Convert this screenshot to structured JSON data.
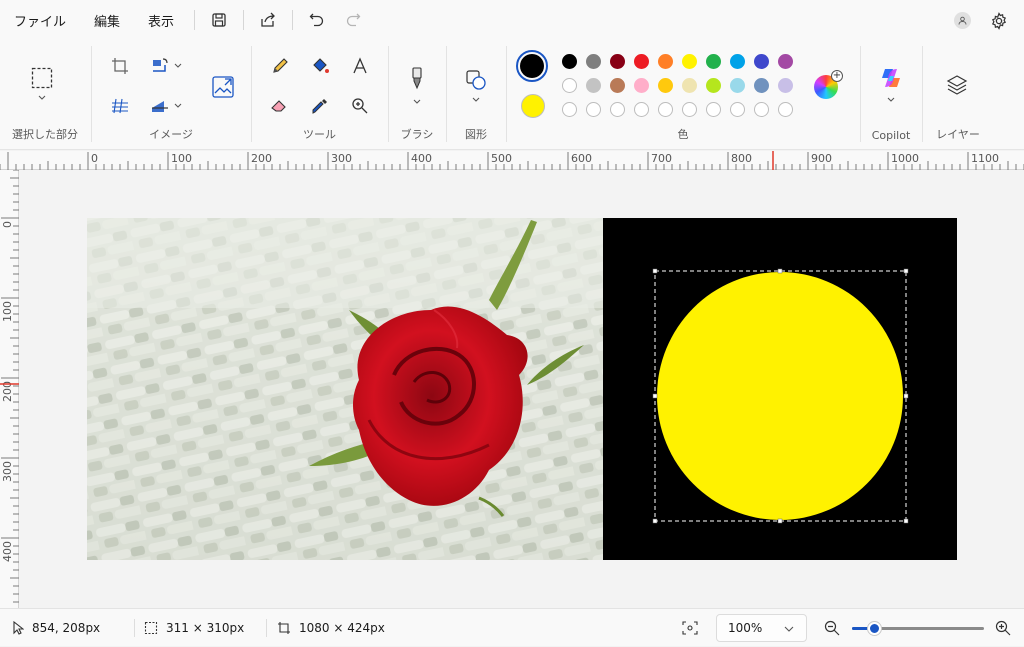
{
  "menu": {
    "file": "ファイル",
    "edit": "編集",
    "view": "表示"
  },
  "groups": {
    "selection": "選択した部分",
    "image": "イメージ",
    "tools": "ツール",
    "brush": "ブラシ",
    "shapes": "図形",
    "colors": "色",
    "copilot": "Copilot",
    "layers": "レイヤー"
  },
  "colors": {
    "primary": "#000000",
    "secondary": "#fff200",
    "palette_row1": [
      "#000000",
      "#7f7f7f",
      "#880015",
      "#ed1c24",
      "#ff7f27",
      "#fff200",
      "#22b14c",
      "#00a2e8",
      "#3f48cc",
      "#a349a4"
    ],
    "palette_row2": [
      "#ffffff",
      "#c3c3c3",
      "#b97a57",
      "#ffaec9",
      "#ffc90e",
      "#efe4b0",
      "#b5e61d",
      "#99d9ea",
      "#7092be",
      "#c8bfe7"
    ]
  },
  "ruler": {
    "h": [
      "0",
      "100",
      "200",
      "300",
      "400",
      "500",
      "600",
      "700",
      "800",
      "900",
      "1000",
      "1100"
    ],
    "v": [
      "0",
      "100",
      "200",
      "300",
      "400"
    ]
  },
  "status": {
    "cursor": "854, 208px",
    "selection": "311 × 310px",
    "canvas": "1080 × 424px",
    "zoom": "100%",
    "zoom_fraction": 0.17
  }
}
